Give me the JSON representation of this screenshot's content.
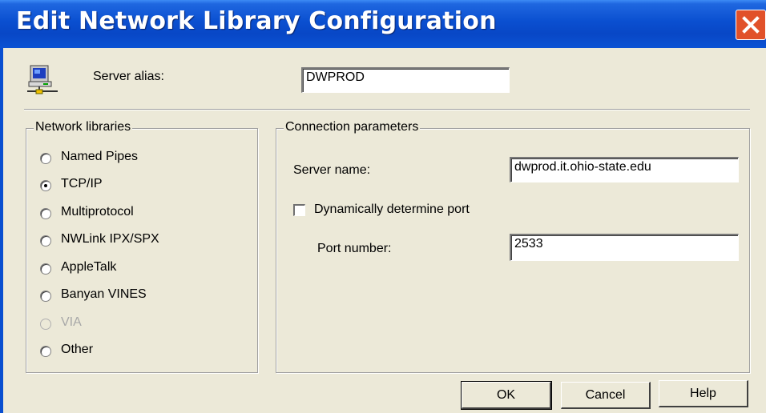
{
  "window": {
    "title": "Edit Network Library Configuration",
    "close_icon": "close-icon",
    "title_bar_color": "#0a4fd0",
    "close_button_color": "#e1512a"
  },
  "server_alias": {
    "icon": "computer-network-icon",
    "label": "Server alias:",
    "value": "DWPROD"
  },
  "network_libraries": {
    "legend": "Network libraries",
    "selected": "TCP/IP",
    "options": [
      {
        "label": "Named Pipes",
        "checked": false,
        "enabled": true
      },
      {
        "label": "TCP/IP",
        "checked": true,
        "enabled": true
      },
      {
        "label": "Multiprotocol",
        "checked": false,
        "enabled": true
      },
      {
        "label": "NWLink IPX/SPX",
        "checked": false,
        "enabled": true
      },
      {
        "label": "AppleTalk",
        "checked": false,
        "enabled": true
      },
      {
        "label": "Banyan VINES",
        "checked": false,
        "enabled": true
      },
      {
        "label": "VIA",
        "checked": false,
        "enabled": false
      },
      {
        "label": "Other",
        "checked": false,
        "enabled": true
      }
    ]
  },
  "connection_parameters": {
    "legend": "Connection parameters",
    "server_name_label": "Server name:",
    "server_name_value": "dwprod.it.ohio-state.edu",
    "dynamic_port_label": "Dynamically determine port",
    "dynamic_port_checked": false,
    "port_number_label": "Port number:",
    "port_number_value": "2533"
  },
  "buttons": {
    "ok": "OK",
    "cancel": "Cancel",
    "help": "Help"
  }
}
